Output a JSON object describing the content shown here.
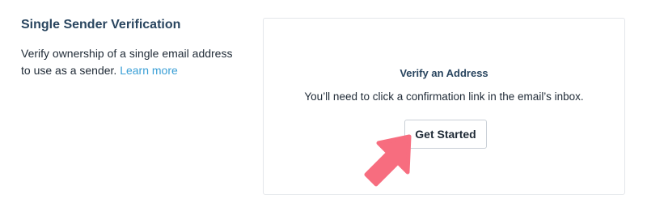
{
  "section": {
    "title": "Single Sender Verification",
    "description": "Verify ownership of a single email address to use as a sender.",
    "learn_more_label": "Learn more"
  },
  "card": {
    "title": "Verify an Address",
    "text": "You’ll need to click a confirmation link in the email’s inbox.",
    "button_label": "Get Started"
  },
  "annotation": {
    "arrow_color": "#f76d7f",
    "arrow_icon": "pointer-arrow-icon"
  },
  "colors": {
    "heading": "#29455f",
    "link": "#3a9fd6",
    "text": "#1f2a36"
  }
}
